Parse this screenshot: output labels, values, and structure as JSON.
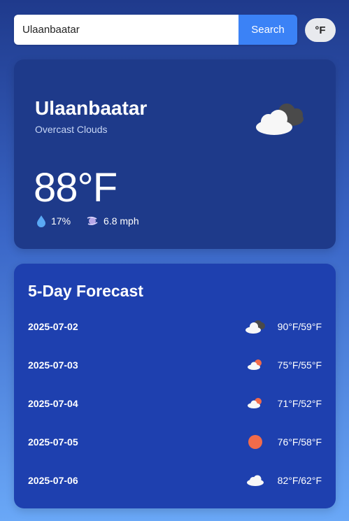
{
  "search": {
    "value": "Ulaanbaatar",
    "button_label": "Search"
  },
  "unit_toggle": {
    "label": "°F"
  },
  "current": {
    "city": "Ulaanbaatar",
    "condition": "Overcast Clouds",
    "temperature": "88°F",
    "humidity": "17%",
    "wind": "6.8 mph",
    "icon": "overcast-clouds-icon"
  },
  "forecast": {
    "title": "5-Day Forecast",
    "days": [
      {
        "date": "2025-07-02",
        "temps": "90°F/59°F",
        "icon": "overcast-clouds-icon"
      },
      {
        "date": "2025-07-03",
        "temps": "75°F/55°F",
        "icon": "partly-cloudy-icon"
      },
      {
        "date": "2025-07-04",
        "temps": "71°F/52°F",
        "icon": "partly-cloudy-icon"
      },
      {
        "date": "2025-07-05",
        "temps": "76°F/58°F",
        "icon": "sun-icon"
      },
      {
        "date": "2025-07-06",
        "temps": "82°F/62°F",
        "icon": "cloud-icon"
      }
    ]
  },
  "colors": {
    "accent": "#3b82f6",
    "current_card": "#1e3a8a",
    "forecast_card": "#1e40af",
    "sun": "#f26b4a"
  }
}
